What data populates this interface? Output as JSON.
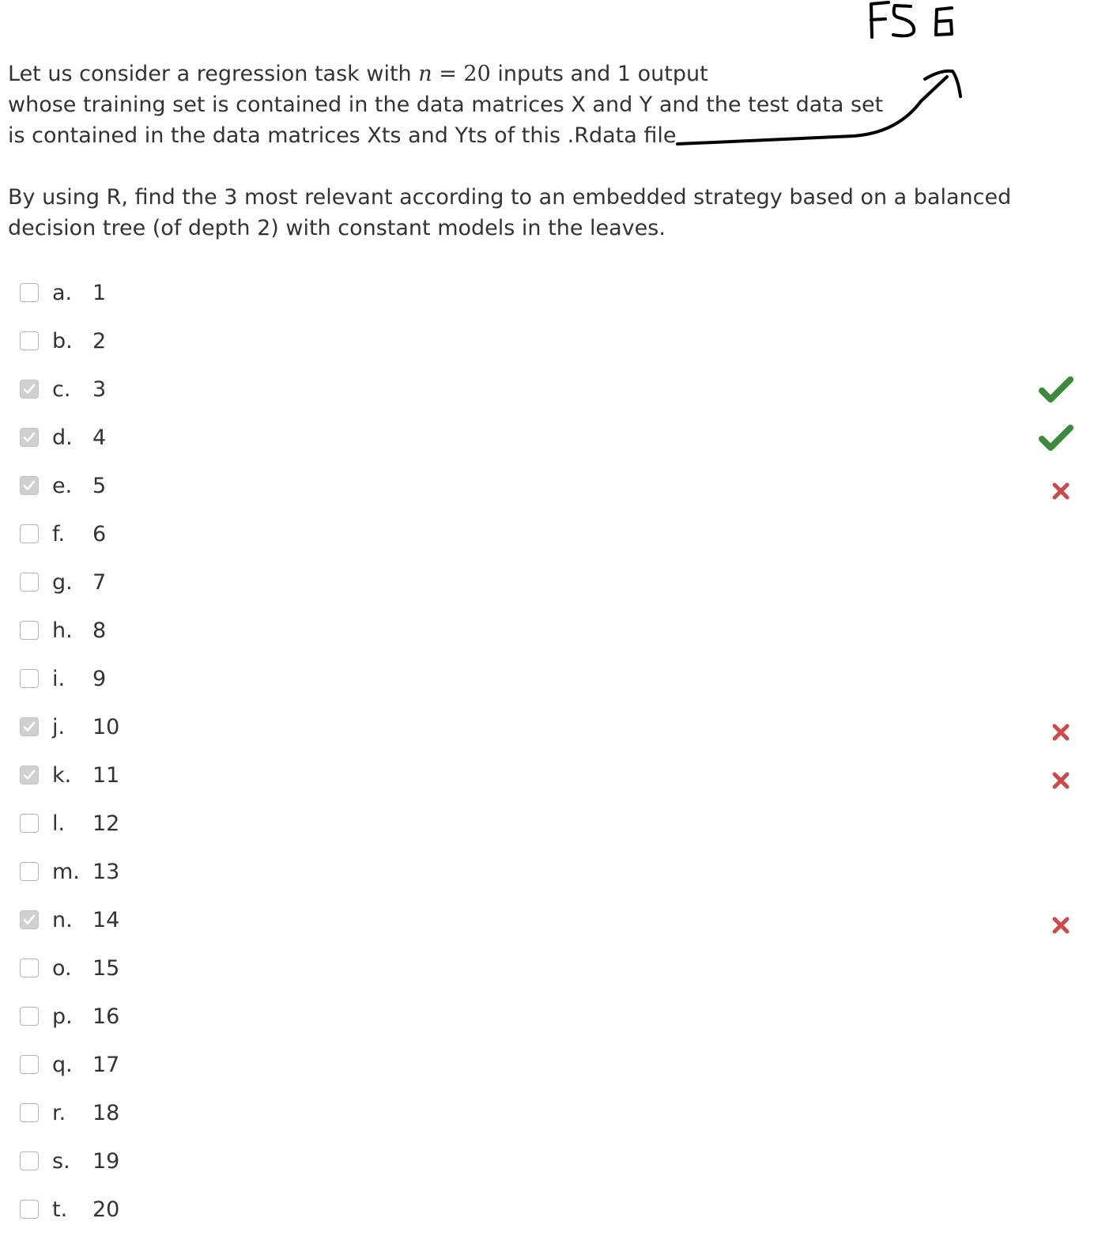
{
  "handwritten_annotation": "FS 6",
  "question": {
    "line1_before": "Let us consider a regression task with ",
    "math_var": "n",
    "math_eq": " = ",
    "math_num": "20",
    "line1_after": " inputs and 1 output",
    "line2": "whose training set is contained in the data matrices X and Y  and the test data set",
    "line3": "is contained in the data matrices Xts and Yts of this .Rdata file",
    "para2_line1": "By using R,  find the 3 most relevant according to an embedded strategy based on a balanced",
    "para2_line2": "decision tree (of depth 2) with constant models in the leaves."
  },
  "options": [
    {
      "letter": "a.",
      "value": "1",
      "checked": false,
      "feedback": "none"
    },
    {
      "letter": "b.",
      "value": "2",
      "checked": false,
      "feedback": "none"
    },
    {
      "letter": "c.",
      "value": "3",
      "checked": true,
      "feedback": "correct"
    },
    {
      "letter": "d.",
      "value": "4",
      "checked": true,
      "feedback": "correct"
    },
    {
      "letter": "e.",
      "value": "5",
      "checked": true,
      "feedback": "incorrect"
    },
    {
      "letter": "f.",
      "value": "6",
      "checked": false,
      "feedback": "none"
    },
    {
      "letter": "g.",
      "value": "7",
      "checked": false,
      "feedback": "none"
    },
    {
      "letter": "h.",
      "value": "8",
      "checked": false,
      "feedback": "none"
    },
    {
      "letter": "i.",
      "value": "9",
      "checked": false,
      "feedback": "none"
    },
    {
      "letter": "j.",
      "value": "10",
      "checked": true,
      "feedback": "incorrect"
    },
    {
      "letter": "k.",
      "value": "11",
      "checked": true,
      "feedback": "incorrect"
    },
    {
      "letter": "l.",
      "value": "12",
      "checked": false,
      "feedback": "none"
    },
    {
      "letter": "m.",
      "value": "13",
      "checked": false,
      "feedback": "none"
    },
    {
      "letter": "n.",
      "value": "14",
      "checked": true,
      "feedback": "incorrect"
    },
    {
      "letter": "o.",
      "value": "15",
      "checked": false,
      "feedback": "none"
    },
    {
      "letter": "p.",
      "value": "16",
      "checked": false,
      "feedback": "none"
    },
    {
      "letter": "q.",
      "value": "17",
      "checked": false,
      "feedback": "none"
    },
    {
      "letter": "r.",
      "value": "18",
      "checked": false,
      "feedback": "none"
    },
    {
      "letter": "s.",
      "value": "19",
      "checked": false,
      "feedback": "none"
    },
    {
      "letter": "t.",
      "value": "20",
      "checked": false,
      "feedback": "none"
    }
  ],
  "colors": {
    "text": "#333333",
    "correct": "#3c8a3c",
    "incorrect": "#ce4a4a",
    "checkbox_checked": "#d0d0d0",
    "checkbox_border": "#b5b5b5",
    "annotation_ink": "#000000"
  },
  "icons": {
    "correct": "check-mark-icon",
    "incorrect": "cross-mark-icon",
    "checkbox_tick": "checkbox-tick-icon"
  }
}
